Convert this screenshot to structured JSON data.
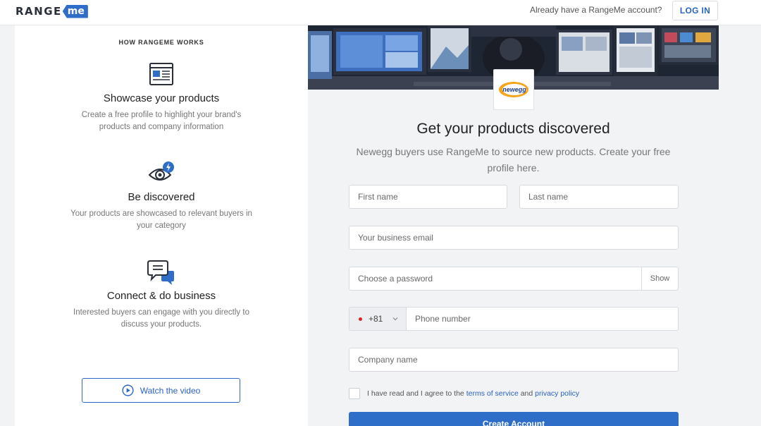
{
  "header": {
    "logo_range": "RANGE",
    "logo_me": "me",
    "account_question": "Already have a RangeMe account?",
    "login_label": "LOG IN"
  },
  "how_it_works": {
    "title": "HOW RANGEME WORKS",
    "features": [
      {
        "icon": "browser-page-icon",
        "title": "Showcase your products",
        "desc": "Create a free profile to highlight your brand's products and company information"
      },
      {
        "icon": "eye-lightning-icon",
        "title": "Be discovered",
        "desc": "Your products are showcased to relevant buyers in your category"
      },
      {
        "icon": "chat-bubbles-icon",
        "title": "Connect & do business",
        "desc": "Interested buyers can engage with you directly to discuss your products."
      }
    ],
    "watch_label": "Watch the video"
  },
  "company": {
    "logo_text": "newegg"
  },
  "form": {
    "title": "Get your products discovered",
    "subtitle": "Newegg buyers use RangeMe to source new products. Create your free profile here.",
    "first_name_placeholder": "First name",
    "last_name_placeholder": "Last name",
    "email_placeholder": "Your business email",
    "password_placeholder": "Choose a password",
    "show_label": "Show",
    "country_code": "+81",
    "phone_placeholder": "Phone number",
    "company_placeholder": "Company name",
    "agree_prefix": "I have read and I agree to the ",
    "terms_label": "terms of service",
    "agree_and": " and ",
    "privacy_label": "privacy policy",
    "create_label": "Create Account"
  },
  "colors": {
    "brand_blue": "#2f6ec8",
    "link_blue": "#2b63c2",
    "flag_red": "#d9252a"
  }
}
